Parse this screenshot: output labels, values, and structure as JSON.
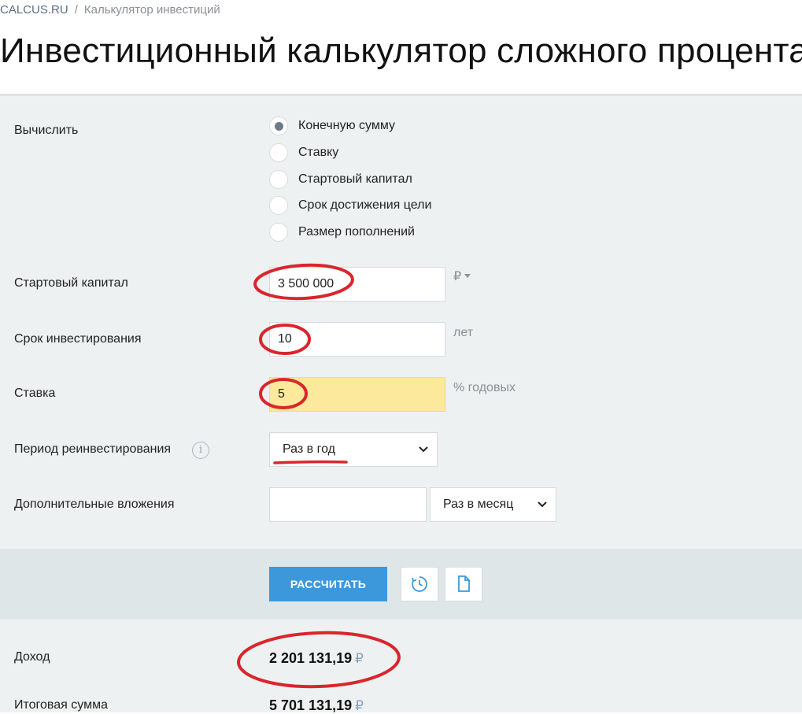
{
  "breadcrumb": {
    "site": "CALCUS.RU",
    "separator": "/",
    "page": "Калькулятор инвестиций"
  },
  "title": "Инвестиционный калькулятор сложного процента",
  "calculate": {
    "label": "Вычислить",
    "options": [
      {
        "label": "Конечную сумму",
        "checked": true
      },
      {
        "label": "Ставку",
        "checked": false
      },
      {
        "label": "Стартовый капитал",
        "checked": false
      },
      {
        "label": "Срок достижения цели",
        "checked": false
      },
      {
        "label": "Размер пополнений",
        "checked": false
      }
    ]
  },
  "start_capital": {
    "label": "Стартовый капитал",
    "value": "3 500 000",
    "currency": "₽"
  },
  "term": {
    "label": "Срок инвестирования",
    "value": "10",
    "unit": "лет"
  },
  "rate": {
    "label": "Ставка",
    "value": "5",
    "unit": "% годовых"
  },
  "reinvest": {
    "label": "Период реинвестирования",
    "value": "Раз в год"
  },
  "additional": {
    "label": "Дополнительные вложения",
    "value": "",
    "period": "Раз в месяц"
  },
  "actions": {
    "calculate_label": "РАССЧИТАТЬ"
  },
  "results": {
    "income_label": "Доход",
    "income_value": "2 201 131,19",
    "total_label": "Итоговая сумма",
    "total_value": "5 701 131,19",
    "currency": "₽"
  },
  "colors": {
    "accent": "#3d98db",
    "highlight": "#fde99b",
    "annotation": "#d9262c"
  }
}
